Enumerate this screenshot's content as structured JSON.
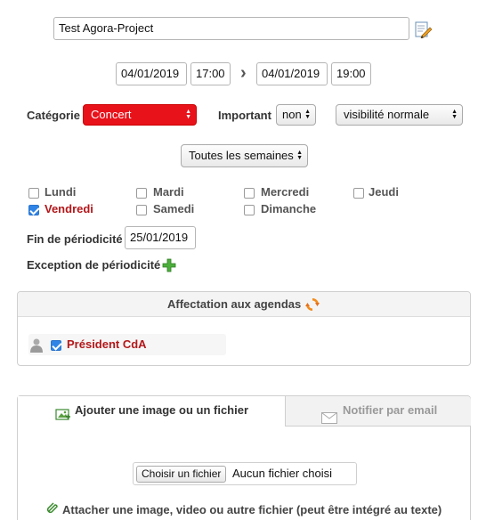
{
  "title_input": {
    "value": "Test Agora-Project"
  },
  "dates": {
    "start_date": "04/01/2019",
    "start_time": "17:00",
    "arrow": "›",
    "end_date": "04/01/2019",
    "end_time": "19:00"
  },
  "category": {
    "label": "Catégorie",
    "value": "Concert",
    "color": "#e8121b"
  },
  "important": {
    "label": "Important",
    "value": "non"
  },
  "visibility": {
    "value": "visibilité normale"
  },
  "recurrence": {
    "value": "Toutes les semaines"
  },
  "weekdays": [
    {
      "label": "Lundi",
      "checked": false
    },
    {
      "label": "Mardi",
      "checked": false
    },
    {
      "label": "Mercredi",
      "checked": false
    },
    {
      "label": "Jeudi",
      "checked": false
    },
    {
      "label": "Vendredi",
      "checked": true
    },
    {
      "label": "Samedi",
      "checked": false
    },
    {
      "label": "Dimanche",
      "checked": false
    }
  ],
  "periodicity_end": {
    "label": "Fin de périodicité",
    "value": "25/01/2019"
  },
  "periodicity_exception": {
    "label": "Exception de périodicité"
  },
  "agendas": {
    "header": "Affectation aux agendas",
    "items": [
      {
        "label": "Président CdA",
        "checked": true
      }
    ]
  },
  "tabs": {
    "attach": "Ajouter une image ou un fichier",
    "notify": "Notifier par email"
  },
  "file": {
    "button": "Choisir un fichier",
    "status": "Aucun fichier choisi"
  },
  "attach_hint": "Attacher une image, video ou autre fichier (peut être intégré au texte)"
}
